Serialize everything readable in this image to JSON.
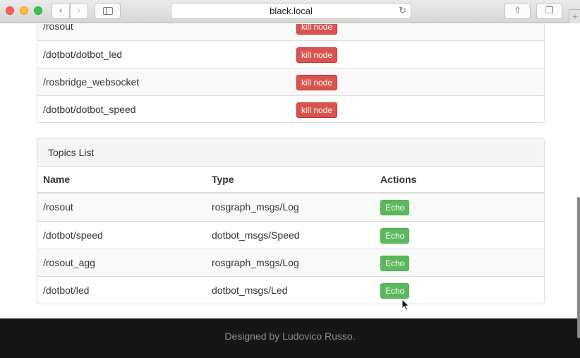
{
  "browser": {
    "url": "black.local",
    "icons": {
      "back": "chevron-left-icon",
      "forward": "chevron-right-icon",
      "sidebar": "sidebar-icon",
      "reload": "reload-icon",
      "share": "share-icon",
      "tabs": "tabs-icon",
      "new_tab": "plus-icon"
    }
  },
  "nodes": {
    "rows": [
      {
        "name": "/rosout",
        "action": "kill node"
      },
      {
        "name": "/dotbot/dotbot_led",
        "action": "kill node"
      },
      {
        "name": "/rosbridge_websocket",
        "action": "kill node"
      },
      {
        "name": "/dotbot/dotbot_speed",
        "action": "kill node"
      }
    ],
    "colors": {
      "danger": "#d9534f"
    }
  },
  "topics": {
    "heading": "Topics List",
    "columns": [
      "Name",
      "Type",
      "Actions"
    ],
    "rows": [
      {
        "name": "/rosout",
        "type": "rosgraph_msgs/Log",
        "action": "Echo"
      },
      {
        "name": "/dotbot/speed",
        "type": "dotbot_msgs/Speed",
        "action": "Echo"
      },
      {
        "name": "/rosout_agg",
        "type": "rosgraph_msgs/Log",
        "action": "Echo"
      },
      {
        "name": "/dotbot/led",
        "type": "dotbot_msgs/Led",
        "action": "Echo"
      }
    ],
    "colors": {
      "success": "#5cb85c"
    }
  },
  "footer": {
    "text": "Designed by Ludovico Russo."
  }
}
